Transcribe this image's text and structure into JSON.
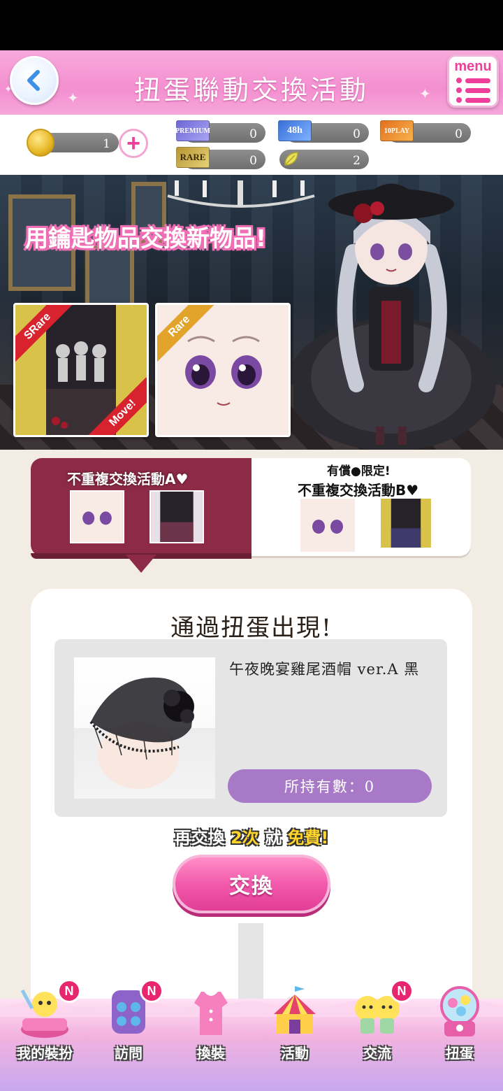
{
  "header": {
    "title": "扭蛋聯動交換活動",
    "menu_label": "menu"
  },
  "currency": {
    "coins": "1",
    "premium_count": "0",
    "premium_label": "PREMIUM",
    "ticket_48h_count": "0",
    "ticket_48h_label": "48h",
    "ticket_10play_count": "0",
    "ticket_10play_label": "10PLAY",
    "rare_count": "0",
    "rare_label": "RARE",
    "leaf_count": "2"
  },
  "banner": {
    "caption": "用鑰匙物品交換新物品!",
    "card_a_badge": "SRare",
    "card_a_move": "Move!",
    "card_b_badge": "Rare"
  },
  "tabs": {
    "a_title": "不重複交換活動A♥",
    "b_note": "有償●限定!",
    "b_title": "不重複交換活動B♥"
  },
  "main": {
    "appear_title": "通過扭蛋出現!",
    "item_name": "午夜晚宴雞尾酒帽 ver.A 黑",
    "owned_text": "所持有數：0",
    "free_note_pre": "再交換",
    "free_note_count": "2次",
    "free_note_mid": "就",
    "free_note_free": "免費!",
    "exchange_label": "交換"
  },
  "nav": {
    "items": [
      {
        "label": "我的裝扮",
        "badge": "N"
      },
      {
        "label": "訪問",
        "badge": "N"
      },
      {
        "label": "換裝",
        "badge": ""
      },
      {
        "label": "活動",
        "badge": ""
      },
      {
        "label": "交流",
        "badge": "N"
      },
      {
        "label": "扭蛋",
        "badge": ""
      }
    ]
  },
  "colors": {
    "header_pink": "#f48fd0",
    "tab_active": "#8c2a47",
    "owned_purple": "#a779c6",
    "exchange_pink": "#f25aac"
  }
}
